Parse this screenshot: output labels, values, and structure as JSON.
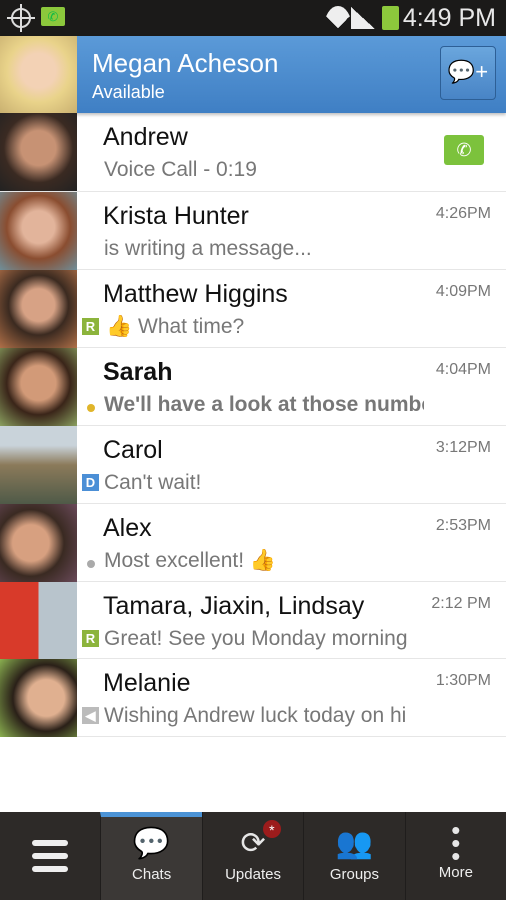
{
  "status_bar": {
    "time": "4:49 PM",
    "icons": [
      "gps-icon",
      "bbm-call-notification-icon",
      "wifi-icon",
      "signal-icon",
      "battery-icon"
    ]
  },
  "header": {
    "name": "Megan Acheson",
    "status": "Available",
    "new_chat_icon": "new-chat-icon"
  },
  "chats": [
    {
      "name": "Andrew",
      "message": "Voice Call - 0:19",
      "time": "",
      "indicator": "voice-call-icon"
    },
    {
      "name": "Krista Hunter",
      "message": "is writing a message...",
      "time": "4:26PM"
    },
    {
      "name": "Matthew Higgins",
      "message": "What time?",
      "time": "4:09PM",
      "badge": "R",
      "emoticon": "thumbs-up-icon"
    },
    {
      "name": "Sarah",
      "message": "We'll have a look at those numbe",
      "time": "4:04PM",
      "unread": true,
      "dot_color": "#e0b52a"
    },
    {
      "name": "Carol",
      "message": "Can't wait!",
      "time": "3:12PM",
      "badge": "D"
    },
    {
      "name": "Alex",
      "message": "Most excellent! 👍",
      "time": "2:53PM",
      "dot_color": "#aaaaaa"
    },
    {
      "name": "Tamara, Jiaxin, Lindsay",
      "message": "Great! See you Monday morning",
      "time": "2:12 PM",
      "badge": "R"
    },
    {
      "name": "Melanie",
      "message": "Wishing Andrew luck today on hi",
      "time": "1:30PM",
      "badge": "broadcast-icon"
    }
  ],
  "nav": {
    "tabs": [
      {
        "label": ""
      },
      {
        "label": "Chats",
        "active": true
      },
      {
        "label": "Updates"
      },
      {
        "label": "Groups"
      },
      {
        "label": "More"
      }
    ]
  },
  "colors": {
    "accent": "#4b93d6",
    "read_badge": "#8cb43c",
    "delivered_badge": "#4b8fd6"
  }
}
